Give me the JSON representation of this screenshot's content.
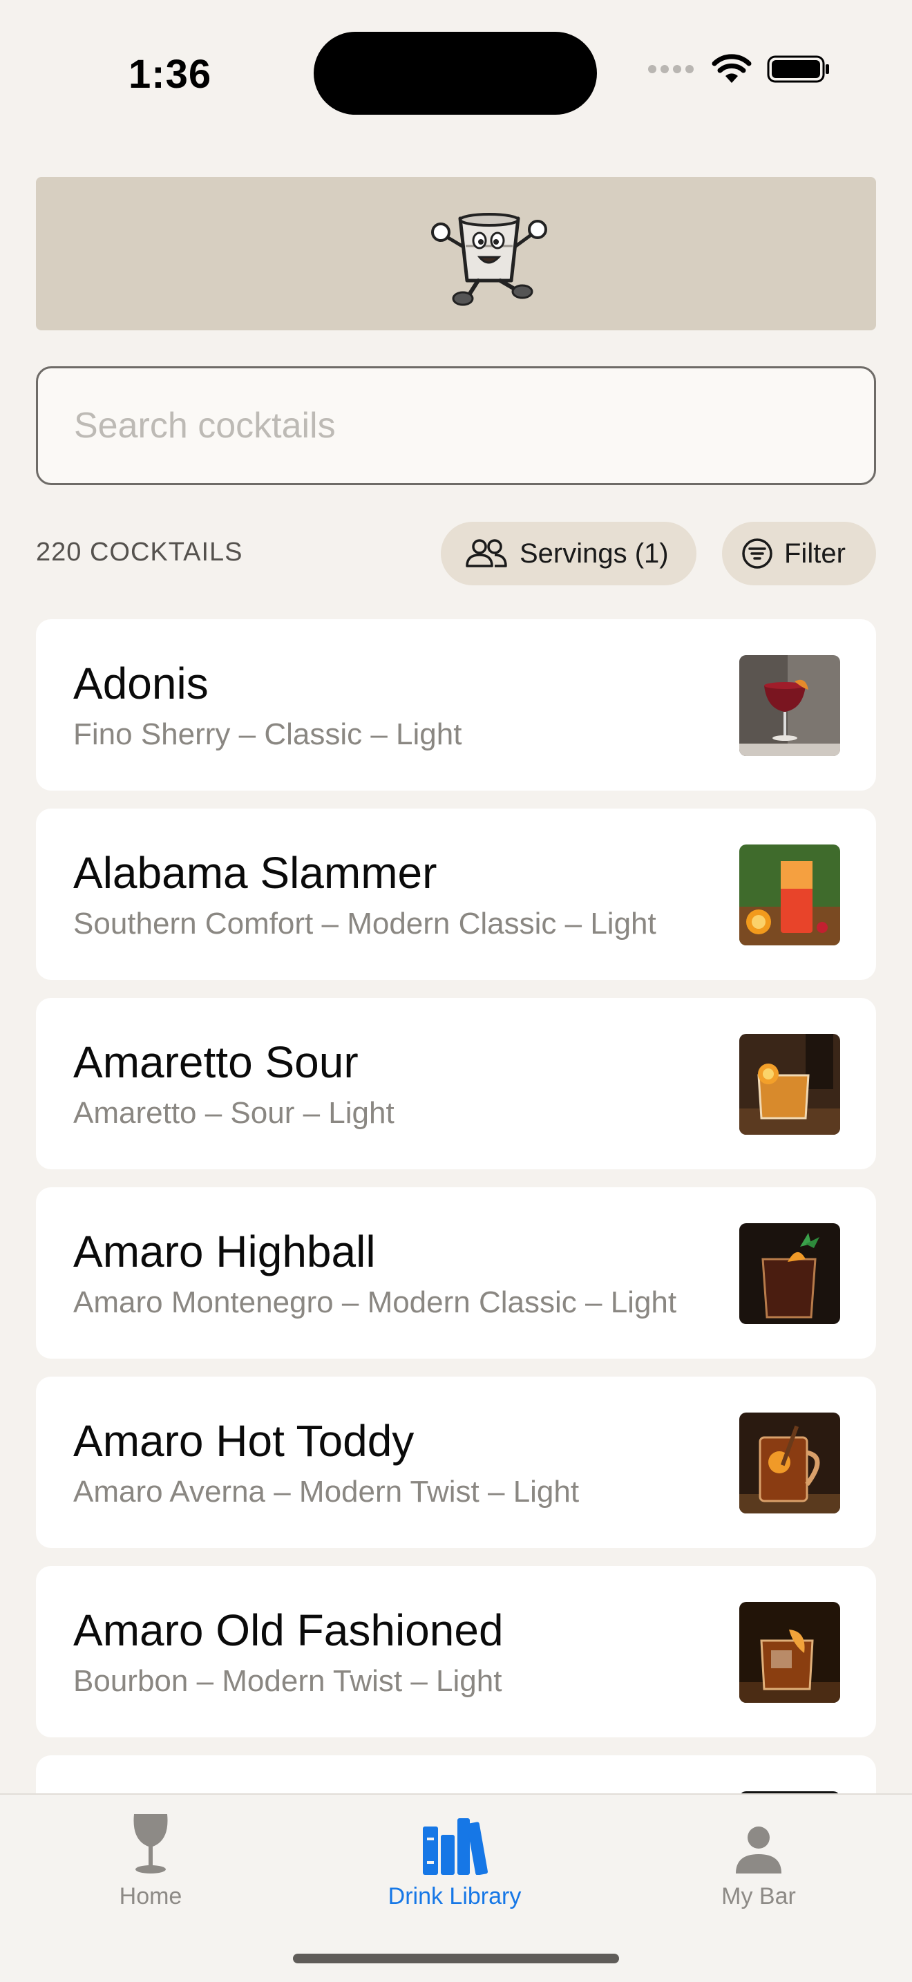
{
  "status_bar": {
    "time": "1:36",
    "icons": [
      "cellular-signal-icon",
      "wifi-icon",
      "battery-icon"
    ]
  },
  "header": {
    "banner_color": "#d7cfc1",
    "mascot_icon": "cocktail-glass-mascot-icon"
  },
  "search": {
    "placeholder": "Search cocktails",
    "value": ""
  },
  "toolbar": {
    "count_label": "220 COCKTAILS",
    "servings_label": "Servings (1)",
    "servings_icon": "people-icon",
    "filter_label": "Filter",
    "filter_icon": "filter-lines-icon"
  },
  "cocktails": [
    {
      "name": "Adonis",
      "meta": "Fino Sherry – Classic – Light",
      "thumb": "coupe-red-drink"
    },
    {
      "name": "Alabama Slammer",
      "meta": "Southern Comfort – Modern Classic – Light",
      "thumb": "highball-red-orange-drink"
    },
    {
      "name": "Amaretto Sour",
      "meta": "Amaretto – Sour – Light",
      "thumb": "rocks-amber-drink"
    },
    {
      "name": "Amaro Highball",
      "meta": "Amaro Montenegro – Modern Classic – Light",
      "thumb": "rocks-dark-mint-drink"
    },
    {
      "name": "Amaro Hot Toddy",
      "meta": "Amaro Averna – Modern Twist – Light",
      "thumb": "mug-hot-toddy"
    },
    {
      "name": "Amaro Old Fashioned",
      "meta": "Bourbon – Modern Twist – Light",
      "thumb": "rocks-orange-peel-drink"
    },
    {
      "name": "",
      "meta": "",
      "thumb": "partially-visible-drink"
    }
  ],
  "tab_bar": {
    "tabs": [
      {
        "label": "Home",
        "icon": "wine-glass-icon",
        "active": false
      },
      {
        "label": "Drink Library",
        "icon": "books-icon",
        "active": true
      },
      {
        "label": "My Bar",
        "icon": "person-icon",
        "active": false
      }
    ],
    "active_color": "#1677e6",
    "inactive_color": "#8d8a86"
  }
}
